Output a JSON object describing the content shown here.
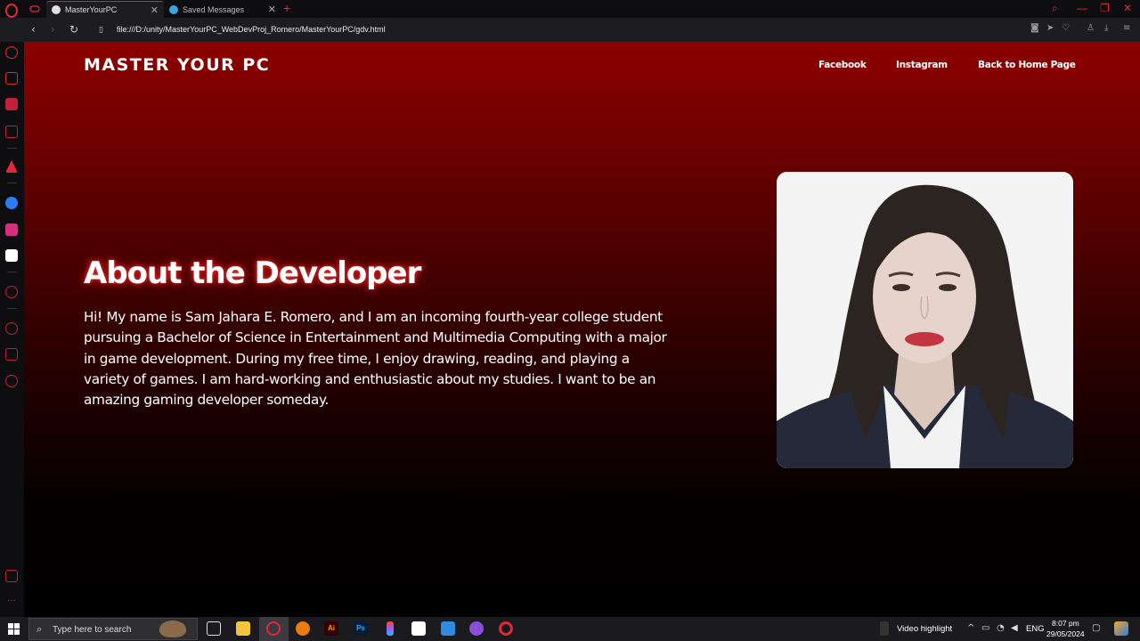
{
  "browser": {
    "tabs": [
      {
        "label": "MasterYourPC",
        "active": true
      },
      {
        "label": "Saved Messages",
        "active": false
      }
    ],
    "new_tab": "+",
    "url": "file:///D:/unity/MasterYourPC_WebDevProj_Romero/MasterYourPC/gdv.html",
    "accent_color": "#e02a3a"
  },
  "site": {
    "brand": "MASTER YOUR PC",
    "nav": [
      {
        "label": "Facebook"
      },
      {
        "label": "Instagram"
      },
      {
        "label": "Back to Home Page"
      }
    ],
    "headline": "About the Developer",
    "bio": "Hi! My name is Sam Jahara E. Romero, and I am an incoming fourth-year college student pursuing a Bachelor of Science in Entertainment and Multimedia Computing with a major in game development. During my free time, I enjoy drawing, reading, and playing a variety of games. I am hard-working and enthusiastic about my studies. I want to be an amazing gaming developer someday.",
    "gradient_top": "#8d0000",
    "gradient_bottom": "#000000"
  },
  "taskbar": {
    "search_placeholder": "Type here to search",
    "widget_label": "Video highlight",
    "language": "ENG",
    "time": "8:07 pm",
    "date": "29/05/2024"
  }
}
